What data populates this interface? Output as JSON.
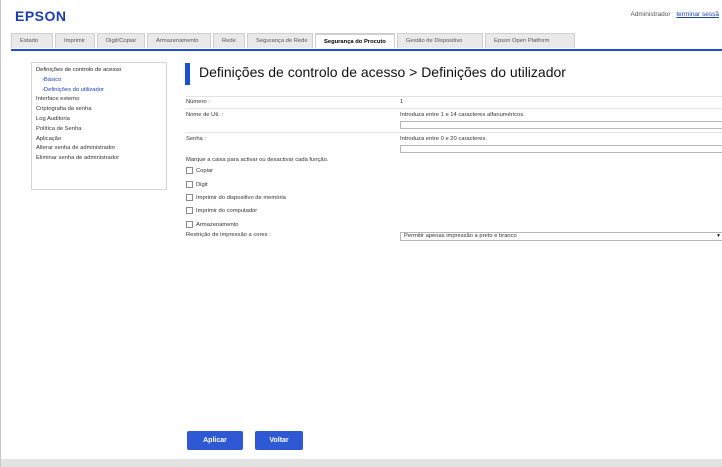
{
  "header": {
    "logo": "EPSON",
    "user": "Administrador",
    "logout": "terminar sessã"
  },
  "tabs": [
    {
      "label": "Estado",
      "active": false
    },
    {
      "label": "Imprimir",
      "active": false
    },
    {
      "label": "Digit/Copiar",
      "active": false
    },
    {
      "label": "Armazenamento",
      "active": false
    },
    {
      "label": "Rede",
      "active": false
    },
    {
      "label": "Segurança de Rede",
      "active": false
    },
    {
      "label": "Segurança do Procuto",
      "active": true
    },
    {
      "label": "Gestão de Dispositivo",
      "active": false
    },
    {
      "label": "Epson Open Platform",
      "active": false
    }
  ],
  "sidebar": {
    "items": [
      {
        "label": "Definições de controlo de acesso",
        "type": "head"
      },
      {
        "label": "›Básico",
        "type": "sub"
      },
      {
        "label": "›Definições do utilizador",
        "type": "sub"
      },
      {
        "label": "Interface externo",
        "type": "item"
      },
      {
        "label": "Criptografia da senha",
        "type": "item"
      },
      {
        "label": "Log Auditoria",
        "type": "item"
      },
      {
        "label": "Política de Senha",
        "type": "item"
      },
      {
        "label": "Aplicação",
        "type": "item"
      },
      {
        "label": "Alterar senha de administrador",
        "type": "item"
      },
      {
        "label": "Eliminar senha de administrador",
        "type": "item"
      }
    ]
  },
  "page": {
    "title": "Definições de controlo de acesso > Definições do utilizador"
  },
  "form": {
    "number_label": "Número :",
    "number_value": "1",
    "username_label": "Nome de Uti. :",
    "username_hint": "Introduza entre 1 e 14 caracteres alfanuméricos.",
    "username_value": "",
    "password_label": "Senha :",
    "password_hint": "Introduza entre 0 e 20 caracteres.",
    "password_value": "",
    "functions_prompt": "Marque a caixa para activar ou desactivar cada função.",
    "functions": [
      {
        "label": "Copiar",
        "checked": false
      },
      {
        "label": "Digit",
        "checked": false
      },
      {
        "label": "Imprimir do dispositivo de memória",
        "checked": false
      },
      {
        "label": "Imprimir do computador",
        "checked": false
      },
      {
        "label": "Armazenamento",
        "checked": false
      }
    ],
    "color_restriction_label": "Restrição de impressão a cores :",
    "color_restriction_value": "Permitir apenas impressão a preto e branco"
  },
  "buttons": {
    "apply": "Aplicar",
    "back": "Voltar"
  },
  "colors": {
    "brand": "#1a3fb3",
    "accent": "#2f59d4"
  }
}
